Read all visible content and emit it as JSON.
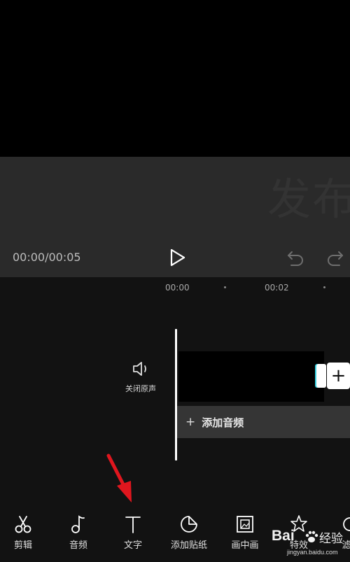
{
  "player": {
    "time_readout": "00:00/00:05",
    "preview_ghost_text": "发布"
  },
  "timeline": {
    "ruler": [
      "00:00",
      "00:02"
    ],
    "mute_label": "关闭原声",
    "add_audio_label": "添加音频",
    "add_clip_symbol": "+"
  },
  "toolbar": {
    "items": [
      {
        "label": "剪辑",
        "icon": "scissors-icon"
      },
      {
        "label": "音频",
        "icon": "music-note-icon"
      },
      {
        "label": "文字",
        "icon": "text-icon"
      },
      {
        "label": "添加贴纸",
        "icon": "sticker-icon"
      },
      {
        "label": "画中画",
        "icon": "picture-in-picture-icon"
      },
      {
        "label": "特效",
        "icon": "effects-star-icon"
      },
      {
        "label": "滤",
        "icon": "filter-icon"
      }
    ]
  },
  "watermark": {
    "brand": "Bai",
    "brand_suffix": "经验",
    "url": "jingyan.baidu.com"
  },
  "colors": {
    "accent_cyan": "#39d0e0",
    "annotation_red": "#e0161e",
    "preview_bg": "#2a2a2a",
    "timeline_bg": "#121212"
  }
}
